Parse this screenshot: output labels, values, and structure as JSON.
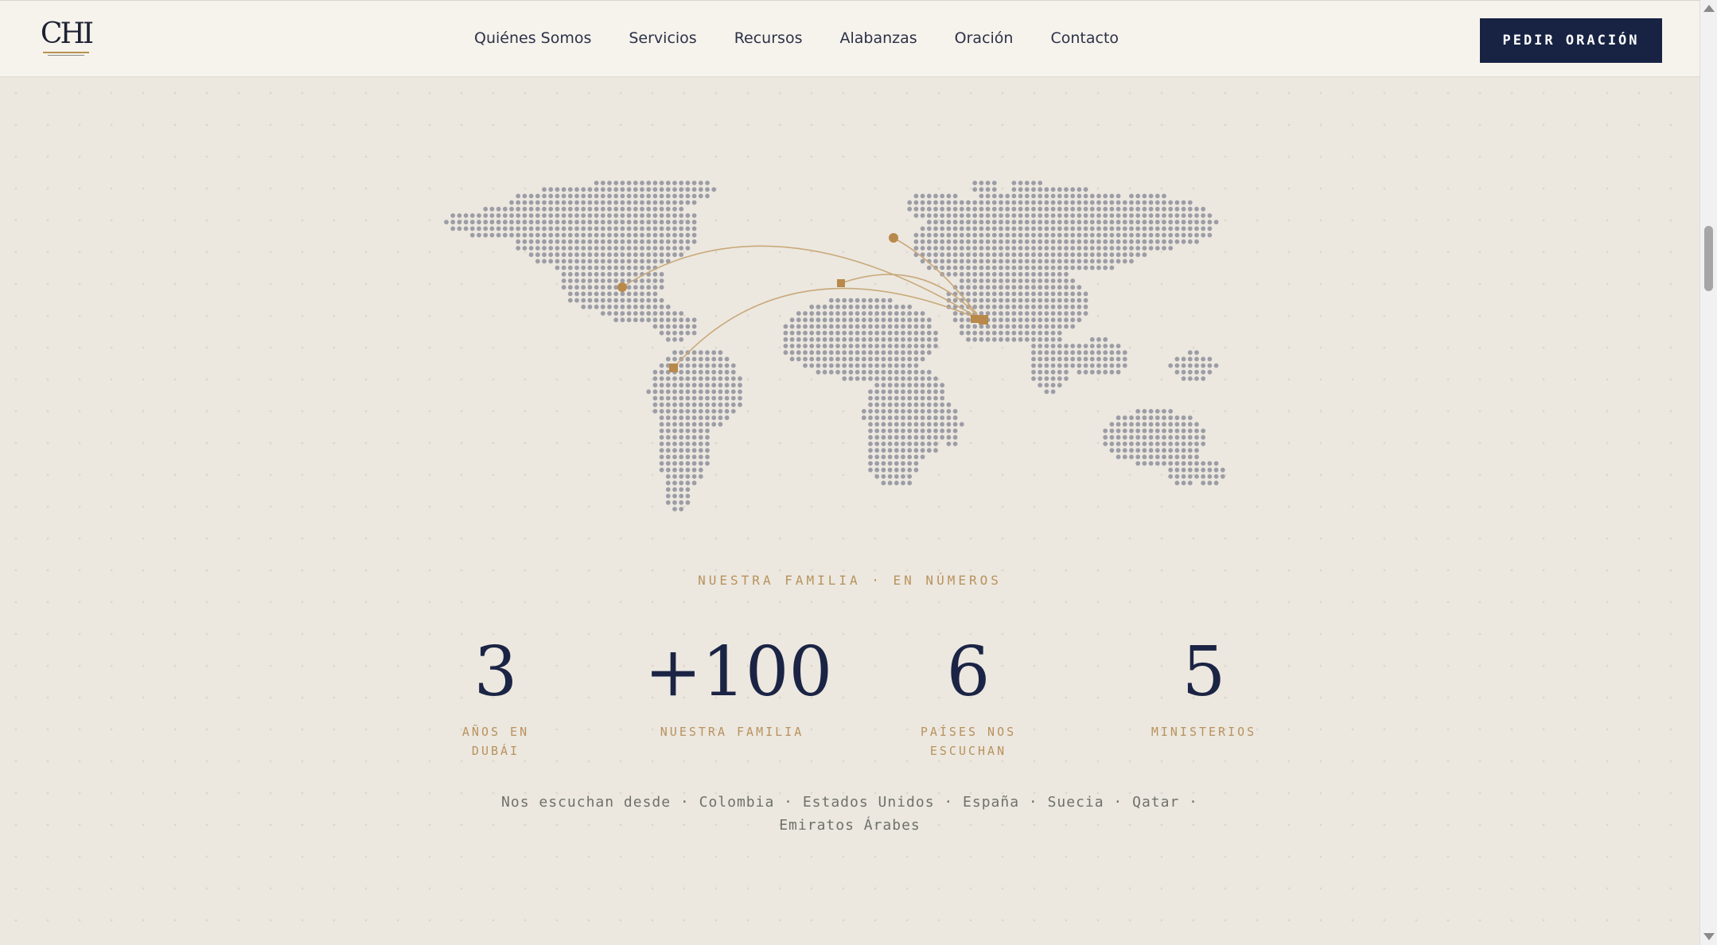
{
  "header": {
    "logo_text": "CHI",
    "nav": [
      "Quiénes Somos",
      "Servicios",
      "Recursos",
      "Alabanzas",
      "Oración",
      "Contacto"
    ],
    "cta_label": "PEDIR ORACIÓN"
  },
  "section": {
    "eyebrow": "NUESTRA FAMILIA · EN NÚMEROS",
    "stats": [
      {
        "value": "3",
        "label": "AÑOS EN DUBÁI"
      },
      {
        "value": "+100",
        "label": "NUESTRA FAMILIA"
      },
      {
        "value": "6",
        "label": "PAÍSES NOS ESCUCHAN"
      },
      {
        "value": "5",
        "label": "MINISTERIOS"
      }
    ],
    "countries_text": "Nos escuchan desde · Colombia · Estados Unidos · España · Suecia · Qatar · Emiratos Árabes"
  },
  "map": {
    "dot_color": "#9d9da6",
    "accent_color": "#b8894a",
    "locations": [
      "Estados Unidos",
      "Colombia",
      "España",
      "Suecia",
      "Qatar",
      "Emiratos Árabes"
    ]
  }
}
